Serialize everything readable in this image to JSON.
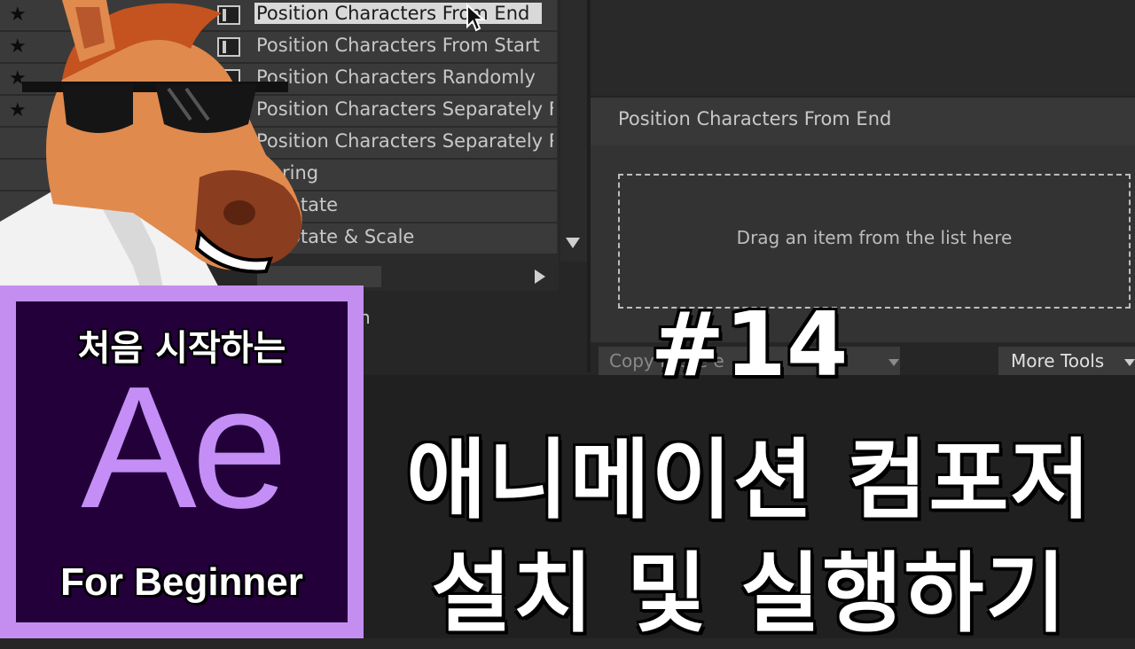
{
  "preset_list": {
    "items": [
      {
        "label": "Position Characters From End",
        "selected": true
      },
      {
        "label": "Position Characters From Start",
        "selected": false
      },
      {
        "label": "Position Characters Randomly",
        "selected": false
      },
      {
        "label": "Position Characters Separately F",
        "selected": false
      },
      {
        "label": "Position Characters Separately R",
        "selected": false
      },
      {
        "label": "ring",
        "selected": false
      },
      {
        "label": "otate",
        "selected": false
      },
      {
        "label": "otate & Scale",
        "selected": false
      }
    ],
    "partial_text": "h"
  },
  "preset_panel": {
    "title": "Position Characters From End",
    "drop_hint": "Drag an item from the list here"
  },
  "toolbar": {
    "copy_paste_label": "Copy   Paste        e",
    "more_tools_label": "More Tools"
  },
  "logo": {
    "top_text": "처음 시작하는",
    "big_text": "Ae",
    "bottom_text": "For Beginner"
  },
  "headline": {
    "episode": "#14",
    "line1": "애니메이션 컴포저",
    "line2": "설치 및 실행하기"
  },
  "colors": {
    "logo_border": "#c38ef0",
    "logo_bg": "#23003a",
    "logo_text": "#c48ef6"
  }
}
